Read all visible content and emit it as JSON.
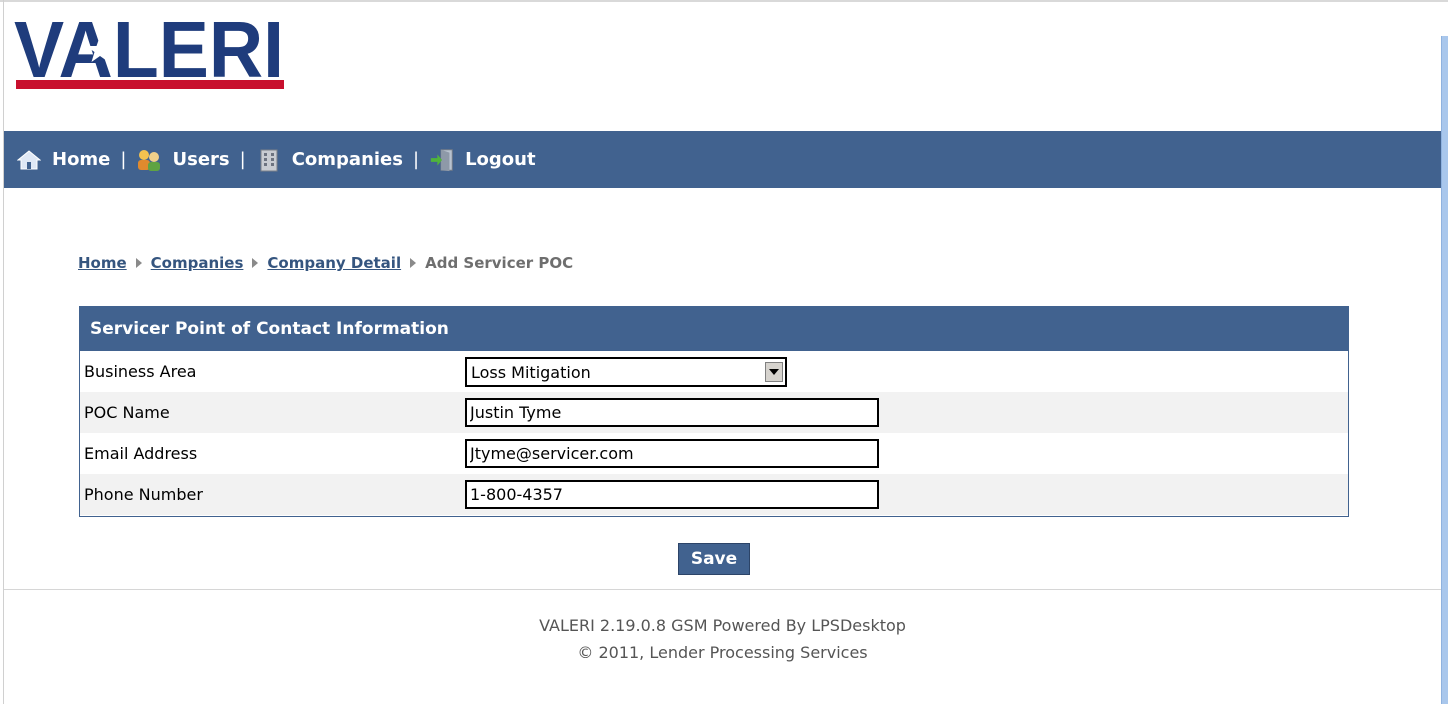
{
  "logo": {
    "text": "VALERI"
  },
  "nav": {
    "items": [
      {
        "label": "Home",
        "icon": "home-icon"
      },
      {
        "label": "Users",
        "icon": "users-icon"
      },
      {
        "label": "Companies",
        "icon": "building-icon"
      },
      {
        "label": "Logout",
        "icon": "logout-icon"
      }
    ],
    "separator": "|"
  },
  "breadcrumb": {
    "links": [
      "Home",
      "Companies",
      "Company Detail"
    ],
    "current": "Add Servicer POC"
  },
  "form": {
    "title": "Servicer Point of Contact Information",
    "business_area": {
      "label": "Business Area",
      "value": "Loss Mitigation"
    },
    "poc_name": {
      "label": "POC Name",
      "value": "Justin Tyme"
    },
    "email": {
      "label": "Email Address",
      "value": "Jtyme@servicer.com"
    },
    "phone": {
      "label": "Phone Number",
      "value": "1-800-4357"
    }
  },
  "actions": {
    "save_label": "Save"
  },
  "footer": {
    "line1": "VALERI 2.19.0.8 GSM Powered By LPSDesktop",
    "line2": "© 2011, Lender Processing Services"
  },
  "colors": {
    "nav_bg": "#41628f",
    "logo_blue": "#1f3c7c",
    "logo_red": "#c8102e",
    "link": "#35557f"
  }
}
